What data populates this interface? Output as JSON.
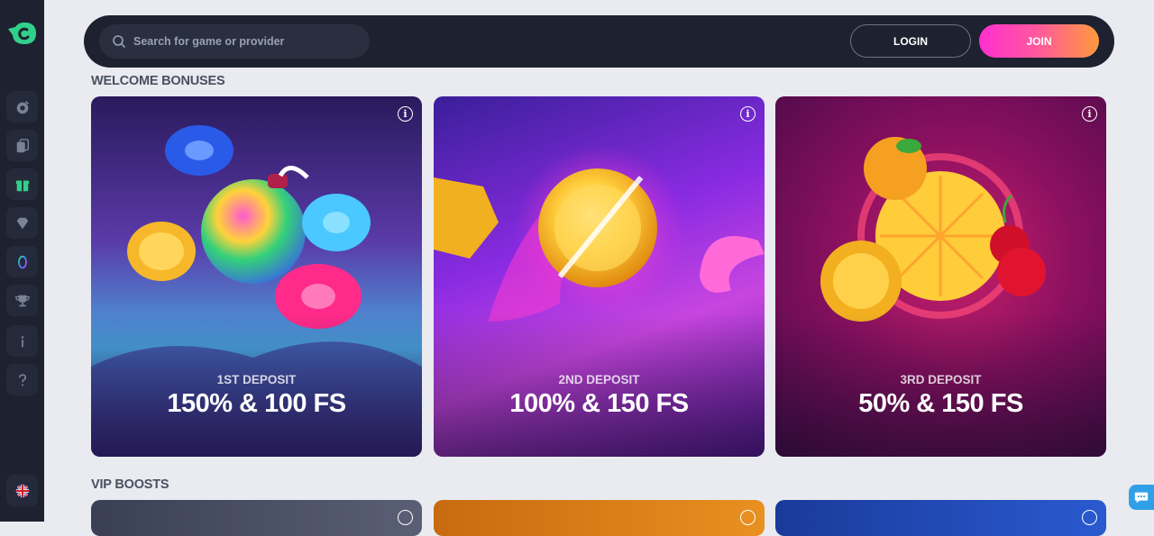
{
  "search": {
    "placeholder": "Search for game or provider"
  },
  "header": {
    "login_label": "LOGIN",
    "join_label": "JOIN"
  },
  "sections": {
    "welcome_title": "WELCOME BONUSES",
    "vip_title": "VIP BOOSTS"
  },
  "cards": [
    {
      "subtitle": "1ST DEPOSIT",
      "offer": "150% & 100 FS"
    },
    {
      "subtitle": "2ND DEPOSIT",
      "offer": "100% & 150 FS"
    },
    {
      "subtitle": "3RD DEPOSIT",
      "offer": "50% & 150 FS"
    }
  ],
  "sidebar": {
    "items": [
      {
        "icon": "casino-chip-icon"
      },
      {
        "icon": "cards-icon"
      },
      {
        "icon": "gift-icon",
        "active": true
      },
      {
        "icon": "diamond-icon"
      },
      {
        "icon": "loyalty-ring-icon"
      },
      {
        "icon": "trophy-icon"
      },
      {
        "icon": "info-icon"
      },
      {
        "icon": "help-icon"
      }
    ],
    "language_icon": "uk-flag-icon"
  },
  "colors": {
    "brand": "#31d08a",
    "sidebar_bg": "#1e2230",
    "join_gradient_start": "#ff2fd0",
    "join_gradient_end": "#ff9a3c",
    "chat": "#2fa0e8"
  }
}
